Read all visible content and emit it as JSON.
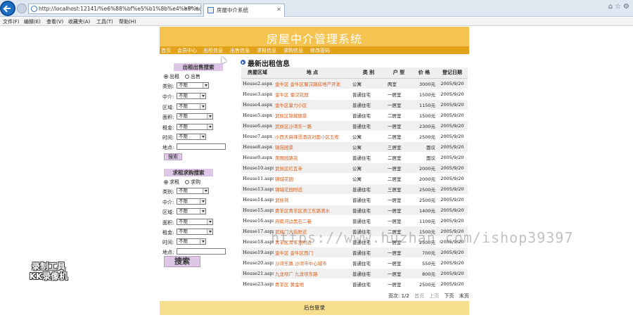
{
  "browser": {
    "url": "http://localhost:12141/%e6%88%bf%e5%b1%8b%e4%b8%ad%",
    "tab_title": "房屋中介系统",
    "menu": [
      "文件(F)",
      "编辑(E)",
      "查看(V)",
      "收藏夹(A)",
      "工具(T)",
      "帮助(H)"
    ]
  },
  "site": {
    "title": "房屋中介管理系统",
    "nav": [
      "首页",
      "会员中心",
      "出租信息",
      "出售信息",
      "求租信息",
      "求购信息",
      "修改密码"
    ]
  },
  "rent_search": {
    "title": "出租出售搜索",
    "options": [
      "出租",
      "出售"
    ],
    "fields": [
      {
        "label": "类别:",
        "value": "不限"
      },
      {
        "label": "中介:",
        "value": "不限"
      },
      {
        "label": "区域:",
        "value": "不限"
      },
      {
        "label": "面积:",
        "value": "不限"
      },
      {
        "label": "租金:",
        "value": "不限"
      },
      {
        "label": "时间:",
        "value": "不限"
      }
    ],
    "address_label": "地点:",
    "button": "搜索"
  },
  "want_search": {
    "title": "求租求购搜索",
    "options": [
      "求租",
      "求购"
    ],
    "fields": [
      {
        "label": "类别:",
        "value": "不限"
      },
      {
        "label": "中介:",
        "value": "不限"
      },
      {
        "label": "区域:",
        "value": "不限"
      },
      {
        "label": "面积:",
        "value": "不限"
      },
      {
        "label": "租金:",
        "value": "不限"
      },
      {
        "label": "时间:",
        "value": "不限"
      }
    ],
    "address_label": "地点:",
    "button": "搜索"
  },
  "listing": {
    "title": "最新出租信息",
    "headers": [
      "房屋区域",
      "地 点",
      "类 别",
      "户 型",
      "价 格",
      "登记日期"
    ],
    "rows": [
      [
        "House2.aspx",
        "金牛区 金牛区蜀汉路房地产开发",
        "公寓",
        "两室",
        "3000元",
        "2005/9/20"
      ],
      [
        "House3.aspx",
        "金牛区 蜀汉花园",
        "普通住宅",
        "一居室",
        "1500元",
        "2005/9/20"
      ],
      [
        "House4.aspx",
        "金牛区量力小区",
        "普通住宅",
        "一居室",
        "1150元",
        "2005/9/20"
      ],
      [
        "House5.aspx",
        "武侯区锦城丽景",
        "普通住宅",
        "二居室",
        "1500元",
        "2005/9/20"
      ],
      [
        "House6.aspx",
        "武侯区沙湾东一路",
        "普通住宅",
        "一居室",
        "2300元",
        "2005/9/20"
      ],
      [
        "House7.aspx",
        "小西天麻辣烫酒店对面小区五栋",
        "公寓",
        "二居室",
        "2500元",
        "2005/9/20"
      ],
      [
        "House8.aspx",
        "锦苑园景",
        "公寓",
        "三居室",
        "面议",
        "2005/9/20"
      ],
      [
        "House9.aspx",
        "美丽园路苑",
        "普通住宅",
        "二居室",
        "面议",
        "2005/9/20"
      ],
      [
        "House10.aspx",
        "武侯区红瓦寺",
        "公寓",
        "一居室",
        "2000元",
        "2005/9/20"
      ],
      [
        "House11.aspx",
        "锦城花园",
        "公寓",
        "二居室",
        "2000元",
        "2005/9/20"
      ],
      [
        "House13.aspx",
        "锦城花园附近",
        "普通住宅",
        "三居室",
        "2500元",
        "2005/9/20"
      ],
      [
        "House14.aspx",
        "武侯祠",
        "普通住宅",
        "一居室",
        "2500元",
        "2005/9/20"
      ],
      [
        "House15.aspx",
        "青羊区青羊区清江东路清水",
        "普通住宅",
        "一居室",
        "1400元",
        "2005/9/20"
      ],
      [
        "House16.aspx",
        "府南河边黑石二巷",
        "普通住宅",
        "一居室",
        "1100元",
        "2005/9/20"
      ],
      [
        "House17.aspx",
        "武侯门大街附近",
        "普通住宅",
        "二居室",
        "1500元",
        "2005/9/20"
      ],
      [
        "House18.aspx",
        "青羊区青羊宫附近",
        "普通住宅",
        "一居室",
        "2500元",
        "2005/9/20"
      ],
      [
        "House19.aspx",
        "金牛区 金牛区西门",
        "普通住宅",
        "一居室",
        "700元",
        "2005/9/20"
      ],
      [
        "House20.aspx",
        "沙湾东路 沙湾市中心城市",
        "普通住宅",
        "一居室",
        "550元",
        "2005/9/20"
      ],
      [
        "House21.aspx",
        "九龙坝广 九龙坝东路",
        "普通住宅",
        "一居室",
        "800元",
        "2005/9/20"
      ],
      [
        "House23.aspx",
        "青羊区 黄金地",
        "普通住宅",
        "一居室",
        "2500元",
        "2005/9/20"
      ]
    ],
    "pager": {
      "info": "页次: 1/2",
      "first": "首页",
      "prev": "上页",
      "next": "下页",
      "last": "末页"
    }
  },
  "footer": {
    "admin_login": "后台登录"
  },
  "overlay": {
    "recorder_line1": "录制工具",
    "recorder_line2": "KK录像机",
    "watermark": "https://www.huzhan.com/ishop39397"
  }
}
